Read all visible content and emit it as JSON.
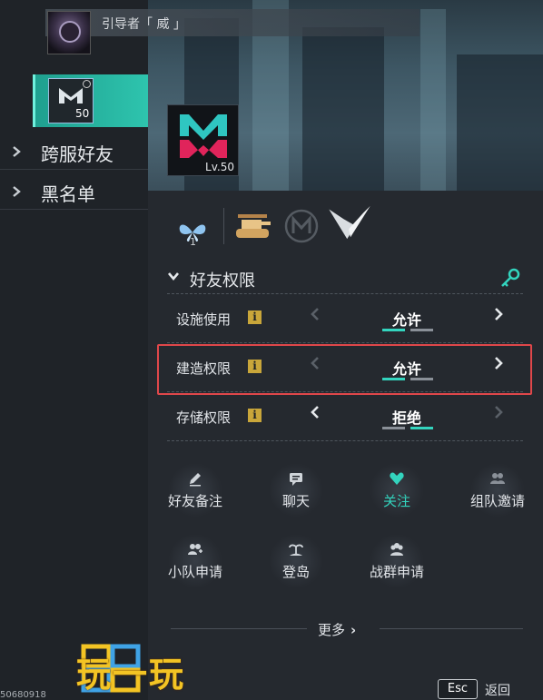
{
  "friend_list": {
    "top_friend": {
      "name": "引导者「 威 」"
    },
    "selected_friend": {
      "level": "50"
    },
    "categories": [
      {
        "label": "跨服好友"
      },
      {
        "label": "黑名单"
      }
    ]
  },
  "profile": {
    "level": "Lv.50",
    "emblem_count": "1",
    "emblems": [
      "butterfly-emblem-icon",
      "tank-emblem-icon",
      "m-circle-emblem-icon",
      "v-wing-emblem-icon"
    ]
  },
  "permissions": {
    "section_title": "好友权限",
    "rows": [
      {
        "name": "设施使用",
        "value": "允许",
        "left_arrow_enabled": false,
        "right_arrow_enabled": true,
        "active_tick": 0
      },
      {
        "name": "建造权限",
        "value": "允许",
        "left_arrow_enabled": false,
        "right_arrow_enabled": true,
        "active_tick": 0
      },
      {
        "name": "存储权限",
        "value": "拒绝",
        "left_arrow_enabled": true,
        "right_arrow_enabled": false,
        "active_tick": 1
      }
    ]
  },
  "actions": [
    {
      "label": "好友备注",
      "icon": "pencil-icon",
      "active": false
    },
    {
      "label": "聊天",
      "icon": "chat-icon",
      "active": false
    },
    {
      "label": "关注",
      "icon": "heart-icon",
      "active": true
    },
    {
      "label": "组队邀请",
      "icon": "team-invite-icon",
      "active": false
    },
    {
      "label": "小队申请",
      "icon": "squad-apply-icon",
      "active": false
    },
    {
      "label": "登岛",
      "icon": "island-icon",
      "active": false
    },
    {
      "label": "战群申请",
      "icon": "group-apply-icon",
      "active": false
    }
  ],
  "more": {
    "label": "更多"
  },
  "footer": {
    "esc_key": "Esc",
    "esc_label": "返回",
    "id_text": "50680918"
  },
  "watermark": {
    "text": "玩一玩"
  },
  "colors": {
    "accent_teal": "#33d4be",
    "highlight_red": "#e0474a",
    "info_gold": "#c9a63a",
    "watermark_gold": "#f3c424"
  }
}
